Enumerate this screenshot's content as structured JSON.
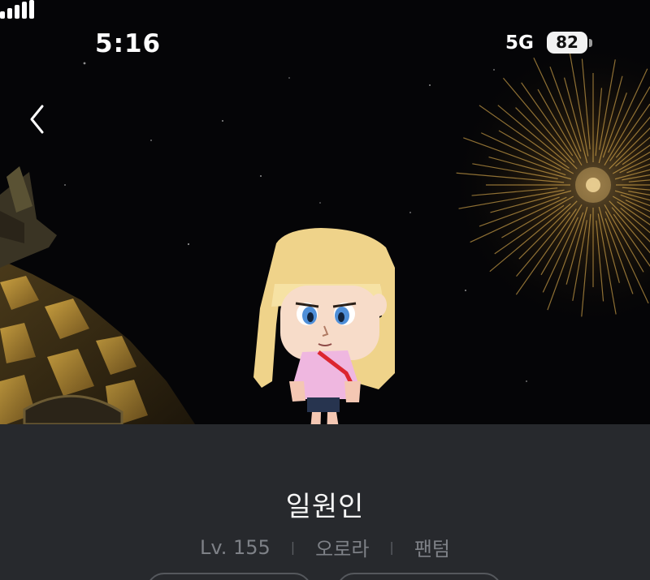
{
  "status_bar": {
    "time": "5:16",
    "network": "5G",
    "battery": "82",
    "signal_icon": "signal-bars-icon"
  },
  "navigation": {
    "back_icon": "chevron-left-icon"
  },
  "scene": {
    "background": "night sky with fireworks",
    "accent_color": "#e8b652"
  },
  "character": {
    "name": "일원인",
    "level": "Lv. 155",
    "world": "오로라",
    "job": "팬텀"
  },
  "colors": {
    "panel": "#27292d",
    "meta_text": "#7e8187"
  }
}
